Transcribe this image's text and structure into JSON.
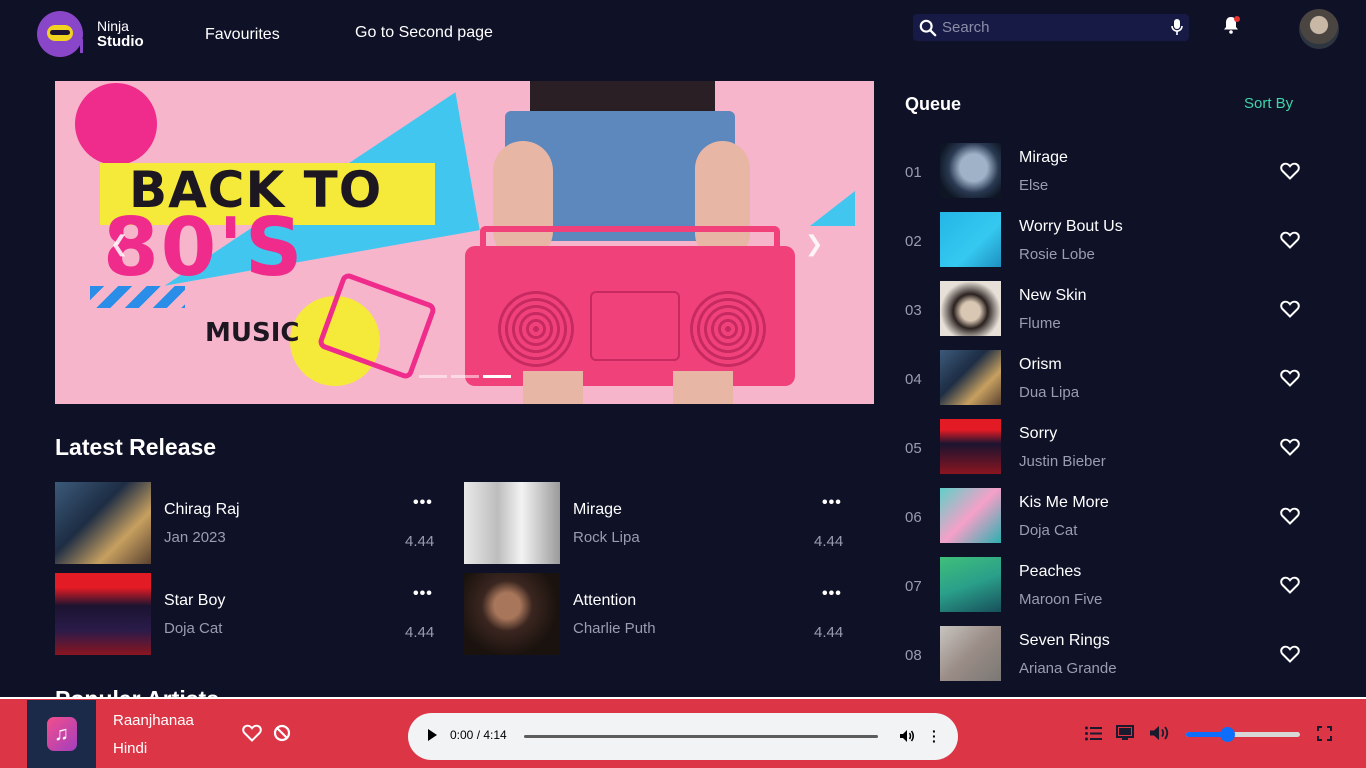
{
  "nav": {
    "logo_line1": "Ninja",
    "logo_line2": "Studio",
    "links": [
      "Favourites",
      "Go to Second page"
    ],
    "search_placeholder": "Search"
  },
  "banner": {
    "headline1": "BACK TO",
    "headline2": "80'S",
    "tagline": "MUSIC",
    "active_slide": 3,
    "slide_count": 3
  },
  "latest": {
    "title": "Latest Release",
    "items": [
      {
        "name": "Chirag Raj",
        "sub": "Jan 2023",
        "duration": "4.44",
        "more": "•••"
      },
      {
        "name": "Mirage",
        "sub": "Rock Lipa",
        "duration": "4.44",
        "more": "•••"
      },
      {
        "name": "Star Boy",
        "sub": "Doja Cat",
        "duration": "4.44",
        "more": "•••"
      },
      {
        "name": "Attention",
        "sub": "Charlie Puth",
        "duration": "4.44",
        "more": "•••"
      }
    ],
    "next_section": "Popular Artists"
  },
  "queue": {
    "title": "Queue",
    "sort_label": "Sort By",
    "items": [
      {
        "num": "01",
        "name": "Mirage",
        "artist": "Else"
      },
      {
        "num": "02",
        "name": "Worry Bout Us",
        "artist": "Rosie Lobe"
      },
      {
        "num": "03",
        "name": "New Skin",
        "artist": "Flume"
      },
      {
        "num": "04",
        "name": "Orism",
        "artist": "Dua Lipa"
      },
      {
        "num": "05",
        "name": "Sorry",
        "artist": "Justin Bieber"
      },
      {
        "num": "06",
        "name": "Kis Me More",
        "artist": "Doja Cat"
      },
      {
        "num": "07",
        "name": "Peaches",
        "artist": "Maroon Five"
      },
      {
        "num": "08",
        "name": "Seven Rings",
        "artist": "Ariana Grande"
      }
    ]
  },
  "player": {
    "song": "Raanjhanaa",
    "language": "Hindi",
    "time": "0:00 / 4:14",
    "progress": 0,
    "volume": 0.36,
    "bar_color": "#dc3545"
  },
  "colors": {
    "background": "#0f1127",
    "accent_green": "#3fd5a8",
    "muted_text": "#9a9cb0"
  }
}
